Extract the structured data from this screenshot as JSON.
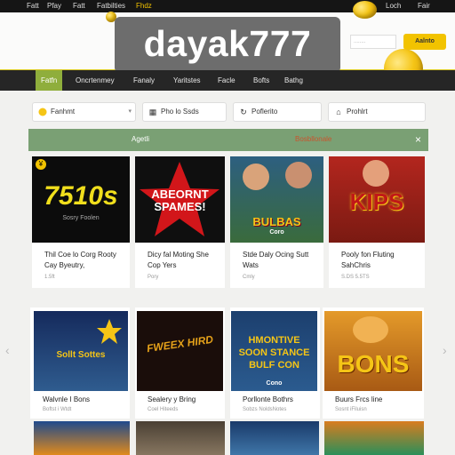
{
  "topbar": {
    "items": [
      "Fatt",
      "Pfay",
      "Fatt",
      "Fatbilties",
      "Fhdz"
    ],
    "right": [
      "Loch",
      "Fair"
    ]
  },
  "header": {
    "brand": "dayak777",
    "search_placeholder": "........",
    "cta_label": "Aalnto"
  },
  "nav": {
    "items": [
      "Fatfn",
      "Oncrtenmey",
      "Fanaly",
      "Yaritstes",
      "Facle",
      "Bofts",
      "Bathg"
    ]
  },
  "filters": [
    {
      "icon": "coin-icon",
      "label": "Fanhmt"
    },
    {
      "icon": "grid-icon",
      "label": "Pho lo Ssds"
    },
    {
      "icon": "refresh-icon",
      "label": "Poflerito"
    },
    {
      "icon": "tag-icon",
      "label": "Prohlrt"
    }
  ],
  "banner": {
    "label": "Agetli",
    "label2": "Bosbllonale"
  },
  "row1": [
    {
      "thumb": "7510s",
      "sub": "Sosry Foolen",
      "title": "Thil Coe lo Corg Rooty Cay Byeutry,",
      "meta": "1.5ft"
    },
    {
      "thumb": "ABEORNT SPAMES!",
      "title": "Dicy fal Moting She Cop Yers",
      "meta": "Pory"
    },
    {
      "thumb": "BULBAS",
      "sub": "Coro",
      "title": "Stde Daly Ocing Sutt Wats",
      "meta": "Cmly"
    },
    {
      "thumb": "KIPS",
      "title": "Pooly fon Fluting SahChris",
      "meta": "S.DS 5.5TS"
    }
  ],
  "row2": [
    {
      "thumb": "Sollt Sottes",
      "title": "Walvnle I Bons",
      "meta": "Boftst i Wtdt"
    },
    {
      "thumb": "FWEEX HIRD",
      "title": "Sealery y Bring",
      "meta": "Coel Hiteeds"
    },
    {
      "thumb": "HMONTIVE SOON STANCE BULF CON",
      "sub": "Cono",
      "title": "Porllonte Bothrs",
      "meta": "Sobzs NoldsNotes"
    },
    {
      "thumb": "BONS",
      "title": "Buurs Frcs line",
      "meta": "Sosnt iFiluisn"
    }
  ],
  "colors": {
    "accent": "#8fae3c",
    "nav_bg": "#262626",
    "banner": "#7aa074",
    "cta": "#f2c300"
  }
}
